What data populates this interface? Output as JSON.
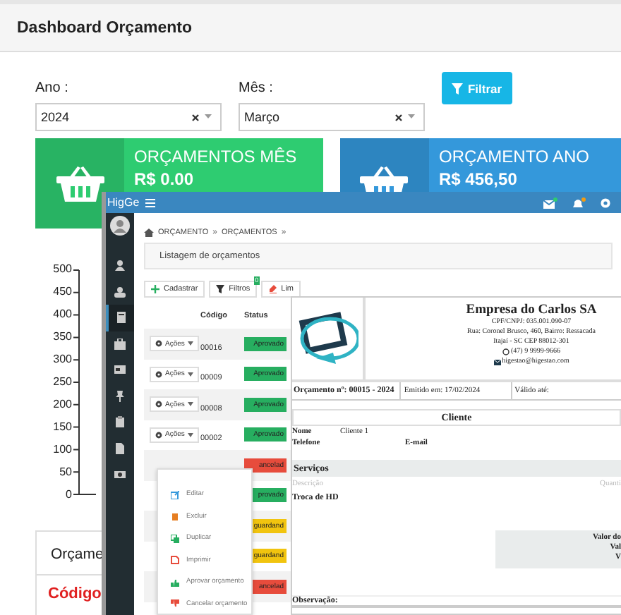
{
  "header": {
    "title": "Dashboard Orçamento"
  },
  "filters": [
    {
      "label": "Ano :",
      "value": "2024"
    },
    {
      "label": "Mês :",
      "value": "Março"
    }
  ],
  "filter_button": {
    "label": "Filtrar"
  },
  "stat_cards": [
    {
      "title": "ORÇAMENTOS MÊS",
      "value": "R$ 0.00",
      "color": "#2ecc71"
    },
    {
      "title": "ORÇAMENTO ANO",
      "value": "R$ 456,50",
      "color": "#3498db"
    }
  ],
  "chart": {
    "axis_labels": [
      "500",
      "450",
      "400",
      "350",
      "300",
      "250",
      "200",
      "150",
      "100",
      "50",
      "0"
    ]
  },
  "table_card": {
    "title": "Orçame",
    "column_1": "Código"
  },
  "window": {
    "title": "HigGe"
  },
  "sidebar": {
    "items": [
      {
        "kind": "user",
        "selected": false
      },
      {
        "kind": "group",
        "selected": false
      },
      {
        "kind": "book",
        "selected": true
      },
      {
        "kind": "briefcase",
        "selected": false
      },
      {
        "kind": "card",
        "selected": false
      },
      {
        "kind": "pin",
        "selected": false
      },
      {
        "kind": "clipboard",
        "selected": false
      },
      {
        "kind": "document",
        "selected": false
      },
      {
        "kind": "camera",
        "selected": false
      }
    ]
  },
  "breadcrumb": [
    {
      "label": "ORÇAMENTO",
      "separator": "»"
    },
    {
      "label": "ORÇAMENTOS",
      "separator": "»"
    }
  ],
  "panel": {
    "title": "Listagem de orçamentos"
  },
  "toolbar": [
    {
      "kind": "add",
      "label": "Cadastrar"
    },
    {
      "kind": "filter",
      "label": "Filtros",
      "badge": "0"
    },
    {
      "kind": "clear",
      "label": "Lim"
    }
  ],
  "table": {
    "columns": [
      "Código",
      "Status"
    ],
    "rows": [
      {
        "action": "Ações",
        "code": "00016",
        "status": "Aprovado",
        "color": "#27ae60"
      },
      {
        "action": "Ações",
        "code": "00009",
        "status": "Aprovado",
        "color": "#27ae60"
      },
      {
        "action": "Ações",
        "code": "00008",
        "status": "Aprovado",
        "color": "#27ae60"
      },
      {
        "action": "Ações",
        "code": "00002",
        "status": "Aprovado",
        "color": "#27ae60"
      },
      {
        "status": "ancelad",
        "color": "#e74c3c"
      },
      {
        "status": "provado",
        "color": "#27ae60"
      },
      {
        "status": "guardand",
        "color": "#f1c40f"
      },
      {
        "status": "guardand",
        "color": "#f1c40f"
      },
      {
        "status": "ancelad",
        "color": "#e74c3c"
      }
    ]
  },
  "row_menu": {
    "items": [
      {
        "kind": "edit",
        "label": "Editar"
      },
      {
        "kind": "delete",
        "label": "Excluir"
      },
      {
        "kind": "duplicate",
        "label": "Duplicar"
      },
      {
        "kind": "print",
        "label": "Imprimir"
      },
      {
        "kind": "approve",
        "label": "Aprovar orçamento"
      },
      {
        "kind": "cancel",
        "label": "Cancelar orçamento"
      }
    ]
  },
  "document": {
    "company": "Empresa do Carlos SA",
    "lines": [
      "CPF/CNPJ: 035.001.090-07",
      "Rua: Coronel Brusco, 460, Bairro: Ressacada",
      "Itajaí - SC CEP 88012-301"
    ],
    "phone": "(47) 9 9999-9666",
    "email": "higestao@higestao.com",
    "number": "Orçamento nº: 00015 - 2024",
    "issued": "Emitido em: 17/02/2024",
    "valid": "Válido até:",
    "client_heading": "Cliente",
    "client": {
      "name_label": "Nome",
      "name": "Cliente 1",
      "phone_label": "Telefone",
      "email_label": "E-mail"
    },
    "services": {
      "heading": "Serviços",
      "columns": [
        "Descrição",
        "Quanti"
      ],
      "items": [
        "Troca de HD"
      ]
    },
    "totals": [
      "Valor do",
      "Val",
      "V"
    ],
    "notes_label": "Observação:"
  }
}
